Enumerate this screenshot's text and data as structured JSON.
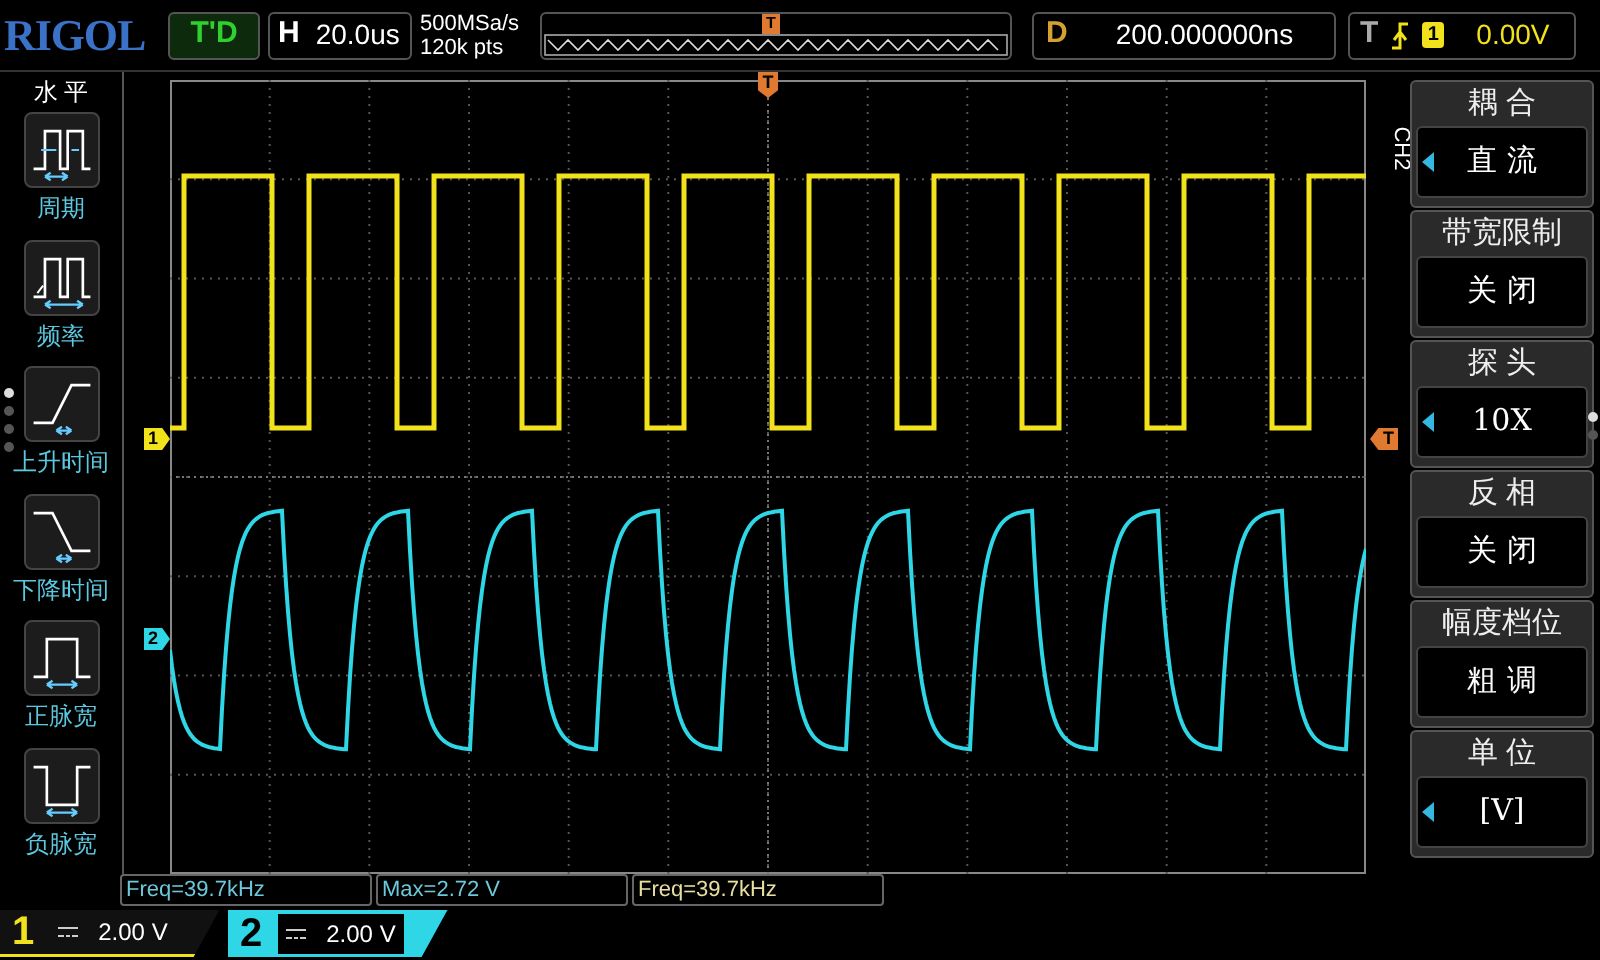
{
  "top_bar": {
    "logo": "RIGOL",
    "run_status": "T'D",
    "timebase": {
      "label": "H",
      "value": "20.0us"
    },
    "sample_rate": "500MSa/s",
    "memory_depth": "120k pts",
    "memory_marker": "T",
    "delay": {
      "label": "D",
      "value": "200.000000ns"
    },
    "trigger": {
      "label": "T",
      "source": "1",
      "level": "0.00V"
    }
  },
  "left_menu": {
    "title": "水 平",
    "items": [
      {
        "label": "周期",
        "kind": "period"
      },
      {
        "label": "频率",
        "kind": "frequency"
      },
      {
        "label": "上升时间",
        "kind": "rise"
      },
      {
        "label": "下降时间",
        "kind": "fall"
      },
      {
        "label": "正脉宽",
        "kind": "positive_width"
      },
      {
        "label": "负脉宽",
        "kind": "negative_width"
      }
    ],
    "pages": [
      {
        "selected": true
      },
      {
        "selected": false
      },
      {
        "selected": false
      },
      {
        "selected": false
      }
    ]
  },
  "grid": {
    "trigger_position_marker": "T",
    "trigger_level_marker": "T",
    "channels": [
      {
        "label": "1",
        "color": "#f2e21c",
        "kind": "square"
      },
      {
        "label": "2",
        "color": "#2fd6e6",
        "kind": "rc"
      }
    ]
  },
  "right_menu": {
    "channel_label": "CH2",
    "items": [
      {
        "title": "耦 合",
        "value": "直 流",
        "arrow": true
      },
      {
        "title": "带宽限制",
        "value": "关 闭",
        "arrow": false
      },
      {
        "title": "探 头",
        "value": "10X",
        "arrow": true
      },
      {
        "title": "反 相",
        "value": "关 闭",
        "arrow": false
      },
      {
        "title": "幅度档位",
        "value": "粗 调",
        "arrow": false
      },
      {
        "title": "单 位",
        "value": "[V]",
        "arrow": true
      }
    ],
    "pages": [
      {
        "selected": true
      },
      {
        "selected": false
      }
    ]
  },
  "measurements": [
    {
      "text": "Freq=39.7kHz",
      "color": "#6cc9dc"
    },
    {
      "text": "Max=2.72 V",
      "color": "#6cc9dc"
    },
    {
      "text": "Freq=39.7kHz",
      "color": "#e8e0a0"
    }
  ],
  "channel_bar": [
    {
      "number": "1",
      "scale": "2.00 V",
      "color": "#f2e21c",
      "selected": false
    },
    {
      "number": "2",
      "scale": "2.00 V",
      "color": "#2fd6e6",
      "selected": true
    }
  ]
}
